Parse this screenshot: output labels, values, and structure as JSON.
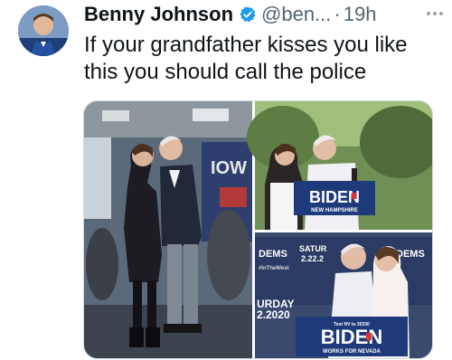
{
  "tweet": {
    "author_name": "Benny Johnson",
    "handle": "@ben...",
    "separator": "·",
    "time": "19h",
    "text": "If your grandfather kisses you like this you should call the police"
  },
  "icons": {
    "verified": "verified-badge-icon",
    "more": "more-options-icon",
    "verified_color": "#1d9bf0"
  },
  "media": {
    "photo_top_right": {
      "sign_main": "BIDEN",
      "sign_sub": "NEW HAMPSHIRE"
    },
    "photo_bottom_right": {
      "backdrop_left": "DEMS",
      "backdrop_right": "DEMS",
      "backdrop_saturday": "SATUR",
      "backdrop_date": "2.22.2",
      "backdrop_hashtag": "#InTheWest",
      "backdrop_urday": "URDAY",
      "backdrop_year": "2.2020",
      "sign_top": "Text NV to 30330",
      "sign_main": "BIDEN",
      "sign_sub": "WORKS FOR NEVADA"
    },
    "photo_left": {
      "wall_text": "IOW"
    }
  }
}
